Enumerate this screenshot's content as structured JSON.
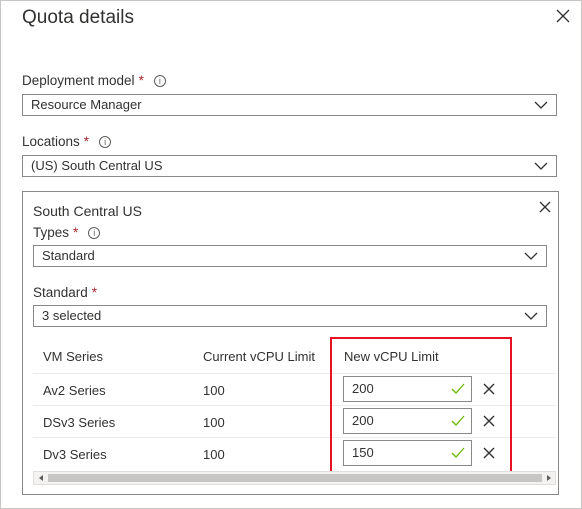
{
  "panel": {
    "title": "Quota details"
  },
  "deployment": {
    "label": "Deployment model",
    "required": "*",
    "info": "i",
    "value": "Resource Manager"
  },
  "locations": {
    "label": "Locations",
    "required": "*",
    "info": "i",
    "value": "(US) South Central US"
  },
  "region": {
    "title": "South Central US",
    "types": {
      "label": "Types",
      "required": "*",
      "info": "i",
      "value": "Standard"
    },
    "standard": {
      "label": "Standard",
      "required": "*",
      "value": "3 selected"
    },
    "table": {
      "headers": [
        "VM Series",
        "Current vCPU Limit",
        "New vCPU Limit"
      ],
      "rows": [
        {
          "series": "Av2 Series",
          "current": "100",
          "new": "200"
        },
        {
          "series": "DSv3 Series",
          "current": "100",
          "new": "200"
        },
        {
          "series": "Dv3 Series",
          "current": "100",
          "new": "150"
        }
      ]
    }
  },
  "colors": {
    "required": "#a4262c",
    "check": "#6bb700",
    "highlight": "#e81123",
    "border": "#8a8886"
  },
  "icons": {
    "close": "close-icon",
    "chevron": "chevron-down-icon",
    "info": "info-icon",
    "check": "checkmark-icon"
  }
}
